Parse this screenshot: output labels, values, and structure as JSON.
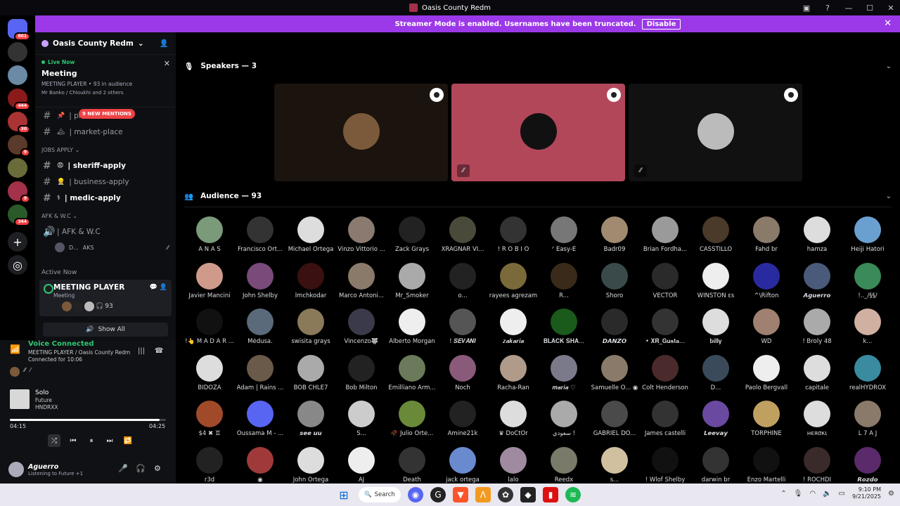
{
  "window": {
    "title": "Oasis County Redm"
  },
  "banner": {
    "text": "Streamer Mode is enabled. Usernames have been truncated.",
    "button": "Disable"
  },
  "guilds": [
    {
      "badge": "801",
      "color": "#5865f2"
    },
    {
      "badge": "",
      "color": "#333"
    },
    {
      "badge": "",
      "color": "#6a8aa5"
    },
    {
      "badge": "444",
      "color": "#8b1a1a"
    },
    {
      "badge": "30",
      "color": "#a33"
    },
    {
      "badge": "9",
      "color": "#5a3a2a"
    },
    {
      "badge": "",
      "color": "#6b6b3a"
    },
    {
      "badge": "9",
      "color": "#a3314a"
    },
    {
      "badge": "344",
      "color": "#2a5a2a"
    }
  ],
  "server": {
    "name": "Oasis County Redm"
  },
  "live": {
    "label": "Live Now",
    "title": "Meeting",
    "sub": "MEETING PLAYER • 93 in audience",
    "who": "Mr Banko / Chloukhi and 2 others"
  },
  "mentions": "9 NEW MENTIONS",
  "channels_top": [
    {
      "name": "| pi",
      "emoji": "📌"
    },
    {
      "name": "| market-place",
      "emoji": "🏔"
    }
  ],
  "cat_jobs": "JOBS APPLY",
  "channels_jobs": [
    {
      "name": "| sheriff-apply",
      "emoji": "😡"
    },
    {
      "name": "| business-apply",
      "emoji": "👷"
    },
    {
      "name": "| medic-apply",
      "emoji": "⚕"
    }
  ],
  "cat_afk": "AFK & W.C",
  "afk_channel": "| AFK & W.C",
  "afk_user": {
    "name": "D...",
    "tag": "AKS"
  },
  "active_now": "Active Now",
  "meeting_player": {
    "title": "MEETING PLAYER",
    "sub": "Meeting",
    "count": "93"
  },
  "show_all": "Show All",
  "voice": {
    "status": "Voice Connected",
    "channel": "MEETING PLAYER / Oasis County Redm",
    "connected": "Connected for 10:06"
  },
  "song": {
    "title": "Solo",
    "artist": "Future",
    "album": "HNDRXX",
    "current": "04:15",
    "total": "04:25",
    "progress": 0.96
  },
  "user": {
    "name": "Aguerro",
    "status": "Listening to Future +1"
  },
  "speakers_label": "Speakers — 3",
  "speakers": [
    {
      "bg": "#1b130e",
      "avatar": "#7a5a3a",
      "muted": false
    },
    {
      "bg": "#b3475a",
      "avatar": "#111",
      "muted": true
    },
    {
      "bg": "#111",
      "avatar": "#bbb",
      "muted": true
    }
  ],
  "audience_label": "Audience — 93",
  "audience": [
    {
      "name": "A N A S",
      "c": "#7a9a7a"
    },
    {
      "name": "Francisco Ort...",
      "c": "#333"
    },
    {
      "name": "Michael Ortega",
      "c": "#ddd"
    },
    {
      "name": "Vinzo Vittorio ...",
      "c": "#8a7a70"
    },
    {
      "name": "Zack Grays",
      "c": "#222"
    },
    {
      "name": "ΧRAGNAR VI...",
      "c": "#4a4a3a"
    },
    {
      "name": "! R O B I O",
      "c": "#333"
    },
    {
      "name": "ᐟ Easy-E",
      "c": "#777"
    },
    {
      "name": "Badr09",
      "c": "#a08a70"
    },
    {
      "name": "Brian Fordha...",
      "c": "#9a9a9a"
    },
    {
      "name": "CASSTILLO",
      "c": "#4a3a2a"
    },
    {
      "name": "Fahd br",
      "c": "#8a7a6a"
    },
    {
      "name": "hamza",
      "c": "#ddd"
    },
    {
      "name": "Heiji Hatori",
      "c": "#6aa0d0"
    },
    {
      "name": "Javier Mancini",
      "c": "#d09a8a"
    },
    {
      "name": "John Shelby",
      "c": "#7a4a7a"
    },
    {
      "name": "lmchkodar",
      "c": "#3a1010"
    },
    {
      "name": "Marco Antoni...",
      "c": "#8a7a6a"
    },
    {
      "name": "Mr_Smoker",
      "c": "#aaa"
    },
    {
      "name": "o...",
      "c": "#222"
    },
    {
      "name": "rayees agrezam",
      "c": "#7a6a3a"
    },
    {
      "name": "R...",
      "c": "#3a2a1a"
    },
    {
      "name": "Shoro",
      "c": "#3a4a4a"
    },
    {
      "name": "VECTOR",
      "c": "#2a2a2a"
    },
    {
      "name": "WINSTON εs",
      "c": "#eee"
    },
    {
      "name": "^\\Rifton",
      "c": "#2a2aa0"
    },
    {
      "name": "𝘼𝙜𝙪𝙚𝙧𝙧𝙤",
      "c": "#4a5a7a"
    },
    {
      "name": "!.._/§§/",
      "c": "#3a8a5a"
    },
    {
      "name": "!👆 M A D A R ...",
      "c": "#111"
    },
    {
      "name": "Médusa.",
      "c": "#5a6a7a"
    },
    {
      "name": "swisita grays",
      "c": "#8a7a5a"
    },
    {
      "name": "Vincenzo🐺",
      "c": "#3a3a4a"
    },
    {
      "name": "Alberto Morgan",
      "c": "#eee"
    },
    {
      "name": "! 𝑺𝑬𝑽𝑨𝑵𝑰",
      "c": "#555"
    },
    {
      "name": "𝒛𝒂𝒌𝒂𝒓𝒊𝒂",
      "c": "#eee"
    },
    {
      "name": "𝐁𝐋𝐀𝐂𝐊 𝐒𝐇𝐀...",
      "c": "#1a5a1a"
    },
    {
      "name": "𝘿𝘼𝙉𝙕𝙊",
      "c": "#2a2a2a"
    },
    {
      "name": "• 𝐗𝐑_𝐆𝐮𝐬𝐭𝐚...",
      "c": "#333"
    },
    {
      "name": "𝐛𝐢𝐥𝐥𝐲",
      "c": "#ddd"
    },
    {
      "name": "WD",
      "c": "#a08070"
    },
    {
      "name": "! Broly 48",
      "c": "#aaa"
    },
    {
      "name": "k...",
      "c": "#d0b0a0"
    },
    {
      "name": "BIDOZA",
      "c": "#ddd"
    },
    {
      "name": "Adam | Rains ...",
      "c": "#6a5a4a"
    },
    {
      "name": "BOB CHLE7",
      "c": "#aaa"
    },
    {
      "name": "Bob Milton",
      "c": "#222"
    },
    {
      "name": "Emilliano Arm...",
      "c": "#6a7a5a"
    },
    {
      "name": "Noch",
      "c": "#8a5a7a"
    },
    {
      "name": "Racha-Ran",
      "c": "#b09a8a"
    },
    {
      "name": "𝒎𝒂𝒓𝒊𝒂 ♡",
      "c": "#7a7a8a"
    },
    {
      "name": "Samuelle O... ◉",
      "c": "#8a7a6a"
    },
    {
      "name": "Colt Henderson",
      "c": "#4a2a2a"
    },
    {
      "name": "D...",
      "c": "#3a4a5a"
    },
    {
      "name": "Paolo Bergvall",
      "c": "#eee"
    },
    {
      "name": "capitale",
      "c": "#ddd"
    },
    {
      "name": "realHYDROX",
      "c": "#3a8aa0"
    },
    {
      "name": "$4 ✖ ♊",
      "c": "#a04a2a"
    },
    {
      "name": "Oussama M - ...",
      "c": "#5865f2"
    },
    {
      "name": "𝙨𝙚𝙚 𝙪𝙪",
      "c": "#888"
    },
    {
      "name": "S...",
      "c": "#ccc"
    },
    {
      "name": "🥀 Julio Orte...",
      "c": "#6a8a3a"
    },
    {
      "name": "Amine21k",
      "c": "#222"
    },
    {
      "name": "♛ DoCtOr",
      "c": "#ddd"
    },
    {
      "name": "سعودي !",
      "c": "#aaa"
    },
    {
      "name": "GABRIEL DO...",
      "c": "#4a4a4a"
    },
    {
      "name": "James castelli",
      "c": "#333"
    },
    {
      "name": "𝙇𝙚𝙚𝙫𝙖𝙮",
      "c": "#6a4aa0"
    },
    {
      "name": "TORPHINE",
      "c": "#c0a060"
    },
    {
      "name": "нєяσκι",
      "c": "#ddd"
    },
    {
      "name": "L 7 A J",
      "c": "#8a7a6a"
    },
    {
      "name": "r3d",
      "c": "#222"
    },
    {
      "name": "◉",
      "c": "#a03a3a"
    },
    {
      "name": "John Ortega",
      "c": "#ddd"
    },
    {
      "name": "AJ",
      "c": "#eee"
    },
    {
      "name": "Death",
      "c": "#333"
    },
    {
      "name": "jack ortega",
      "c": "#6a8ad0"
    },
    {
      "name": "lalo",
      "c": "#a08aa0"
    },
    {
      "name": "Reedx",
      "c": "#7a7a6a"
    },
    {
      "name": "s...",
      "c": "#d0c0a0"
    },
    {
      "name": "! Wlof Shelby",
      "c": "#111"
    },
    {
      "name": "darwin br",
      "c": "#333"
    },
    {
      "name": "Enzo Martelli",
      "c": "#111"
    },
    {
      "name": "! ROCHDI",
      "c": "#3a2a2a"
    },
    {
      "name": "𝙍𝙤𝙯𝙙𝙤",
      "c": "#5a2a6a"
    }
  ],
  "taskbar": {
    "search": "Search",
    "time": "9:10 PM",
    "date": "9/21/2025"
  }
}
